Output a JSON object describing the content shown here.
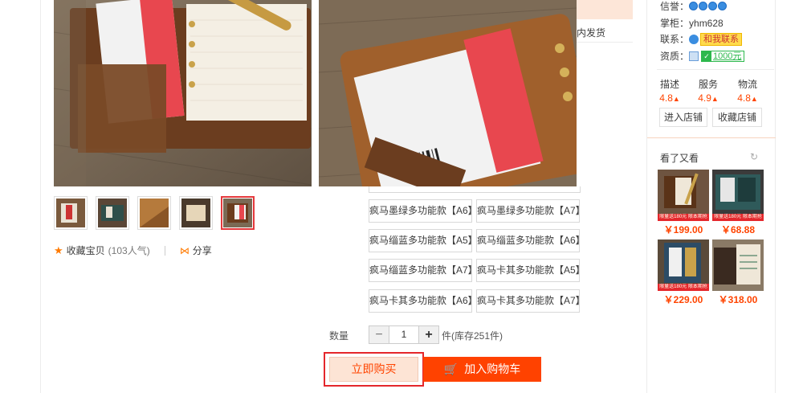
{
  "gallery": {
    "favorite_label": "收藏宝贝",
    "favorite_count": "(103人气)",
    "share_label": "分享",
    "thumb_count": 5,
    "active_thumb_index": 4
  },
  "origin": {
    "text": "内发货"
  },
  "sku_options": [
    "疯马墨绿多功能款【A6】",
    "疯马墨绿多功能款【A7】",
    "疯马缁蓝多功能款【A5】",
    "疯马缁蓝多功能款【A6】",
    "疯马缁蓝多功能款【A7】",
    "疯马卡其多功能款【A5】",
    "疯马卡其多功能款【A6】",
    "疯马卡其多功能款【A7】"
  ],
  "quantity": {
    "label": "数量",
    "minus": "−",
    "value": "1",
    "plus": "+",
    "stock_text": "件(库存251件)"
  },
  "actions": {
    "buy_now": "立即购买",
    "add_to_cart": "加入购物车"
  },
  "shop": {
    "credit_label": "信誉：",
    "keeper_label": "掌柜：",
    "keeper_name": "yhm628",
    "contact_label": "联系：",
    "contact_badge": "和我联系",
    "qualification_label": "资质：",
    "deposit_amount": "1000元",
    "scores": [
      {
        "label": "描述",
        "value": "4.8",
        "arrow": "🡑"
      },
      {
        "label": "服务",
        "value": "4.9",
        "arrow": "🡑"
      },
      {
        "label": "物流",
        "value": "4.8",
        "arrow": "🡑"
      }
    ],
    "enter_shop": "进入店铺",
    "favorite_shop": "收藏店铺"
  },
  "seen": {
    "title": "看了又看",
    "items": [
      {
        "price": "￥199.00",
        "band": "限量送180元 限本期抢"
      },
      {
        "price": "￥68.88",
        "band": "限量送180元 限本期抢"
      },
      {
        "price": "￥229.00",
        "band": "限量送180元 限本期抢"
      },
      {
        "price": "￥318.00",
        "band": ""
      }
    ]
  },
  "colors": {
    "accent": "#ff4200",
    "price": "#ff4400",
    "highlight_border": "#e4272c"
  }
}
